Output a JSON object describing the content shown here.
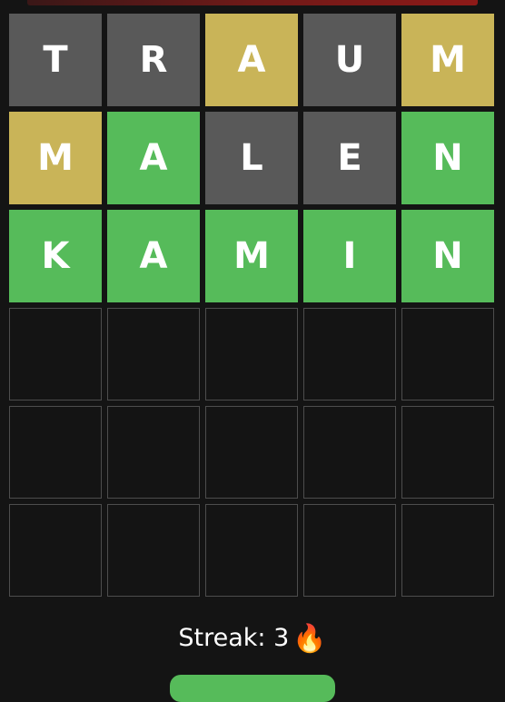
{
  "board": {
    "rows": [
      [
        {
          "letter": "T",
          "state": "absent"
        },
        {
          "letter": "R",
          "state": "absent"
        },
        {
          "letter": "A",
          "state": "present"
        },
        {
          "letter": "U",
          "state": "absent"
        },
        {
          "letter": "M",
          "state": "present"
        }
      ],
      [
        {
          "letter": "M",
          "state": "present"
        },
        {
          "letter": "A",
          "state": "correct"
        },
        {
          "letter": "L",
          "state": "absent"
        },
        {
          "letter": "E",
          "state": "absent"
        },
        {
          "letter": "N",
          "state": "correct"
        }
      ],
      [
        {
          "letter": "K",
          "state": "correct"
        },
        {
          "letter": "A",
          "state": "correct"
        },
        {
          "letter": "M",
          "state": "correct"
        },
        {
          "letter": "I",
          "state": "correct"
        },
        {
          "letter": "N",
          "state": "correct"
        }
      ],
      [
        {
          "letter": "",
          "state": "empty"
        },
        {
          "letter": "",
          "state": "empty"
        },
        {
          "letter": "",
          "state": "empty"
        },
        {
          "letter": "",
          "state": "empty"
        },
        {
          "letter": "",
          "state": "empty"
        }
      ],
      [
        {
          "letter": "",
          "state": "empty"
        },
        {
          "letter": "",
          "state": "empty"
        },
        {
          "letter": "",
          "state": "empty"
        },
        {
          "letter": "",
          "state": "empty"
        },
        {
          "letter": "",
          "state": "empty"
        }
      ],
      [
        {
          "letter": "",
          "state": "empty"
        },
        {
          "letter": "",
          "state": "empty"
        },
        {
          "letter": "",
          "state": "empty"
        },
        {
          "letter": "",
          "state": "empty"
        },
        {
          "letter": "",
          "state": "empty"
        }
      ]
    ]
  },
  "streak": {
    "label": "Streak: 3",
    "icon": "fire-icon"
  },
  "colors": {
    "absent": "#595959",
    "present": "#c9b458",
    "correct": "#56bb5a",
    "background": "#141414",
    "empty_border": "#4d4d4d"
  }
}
